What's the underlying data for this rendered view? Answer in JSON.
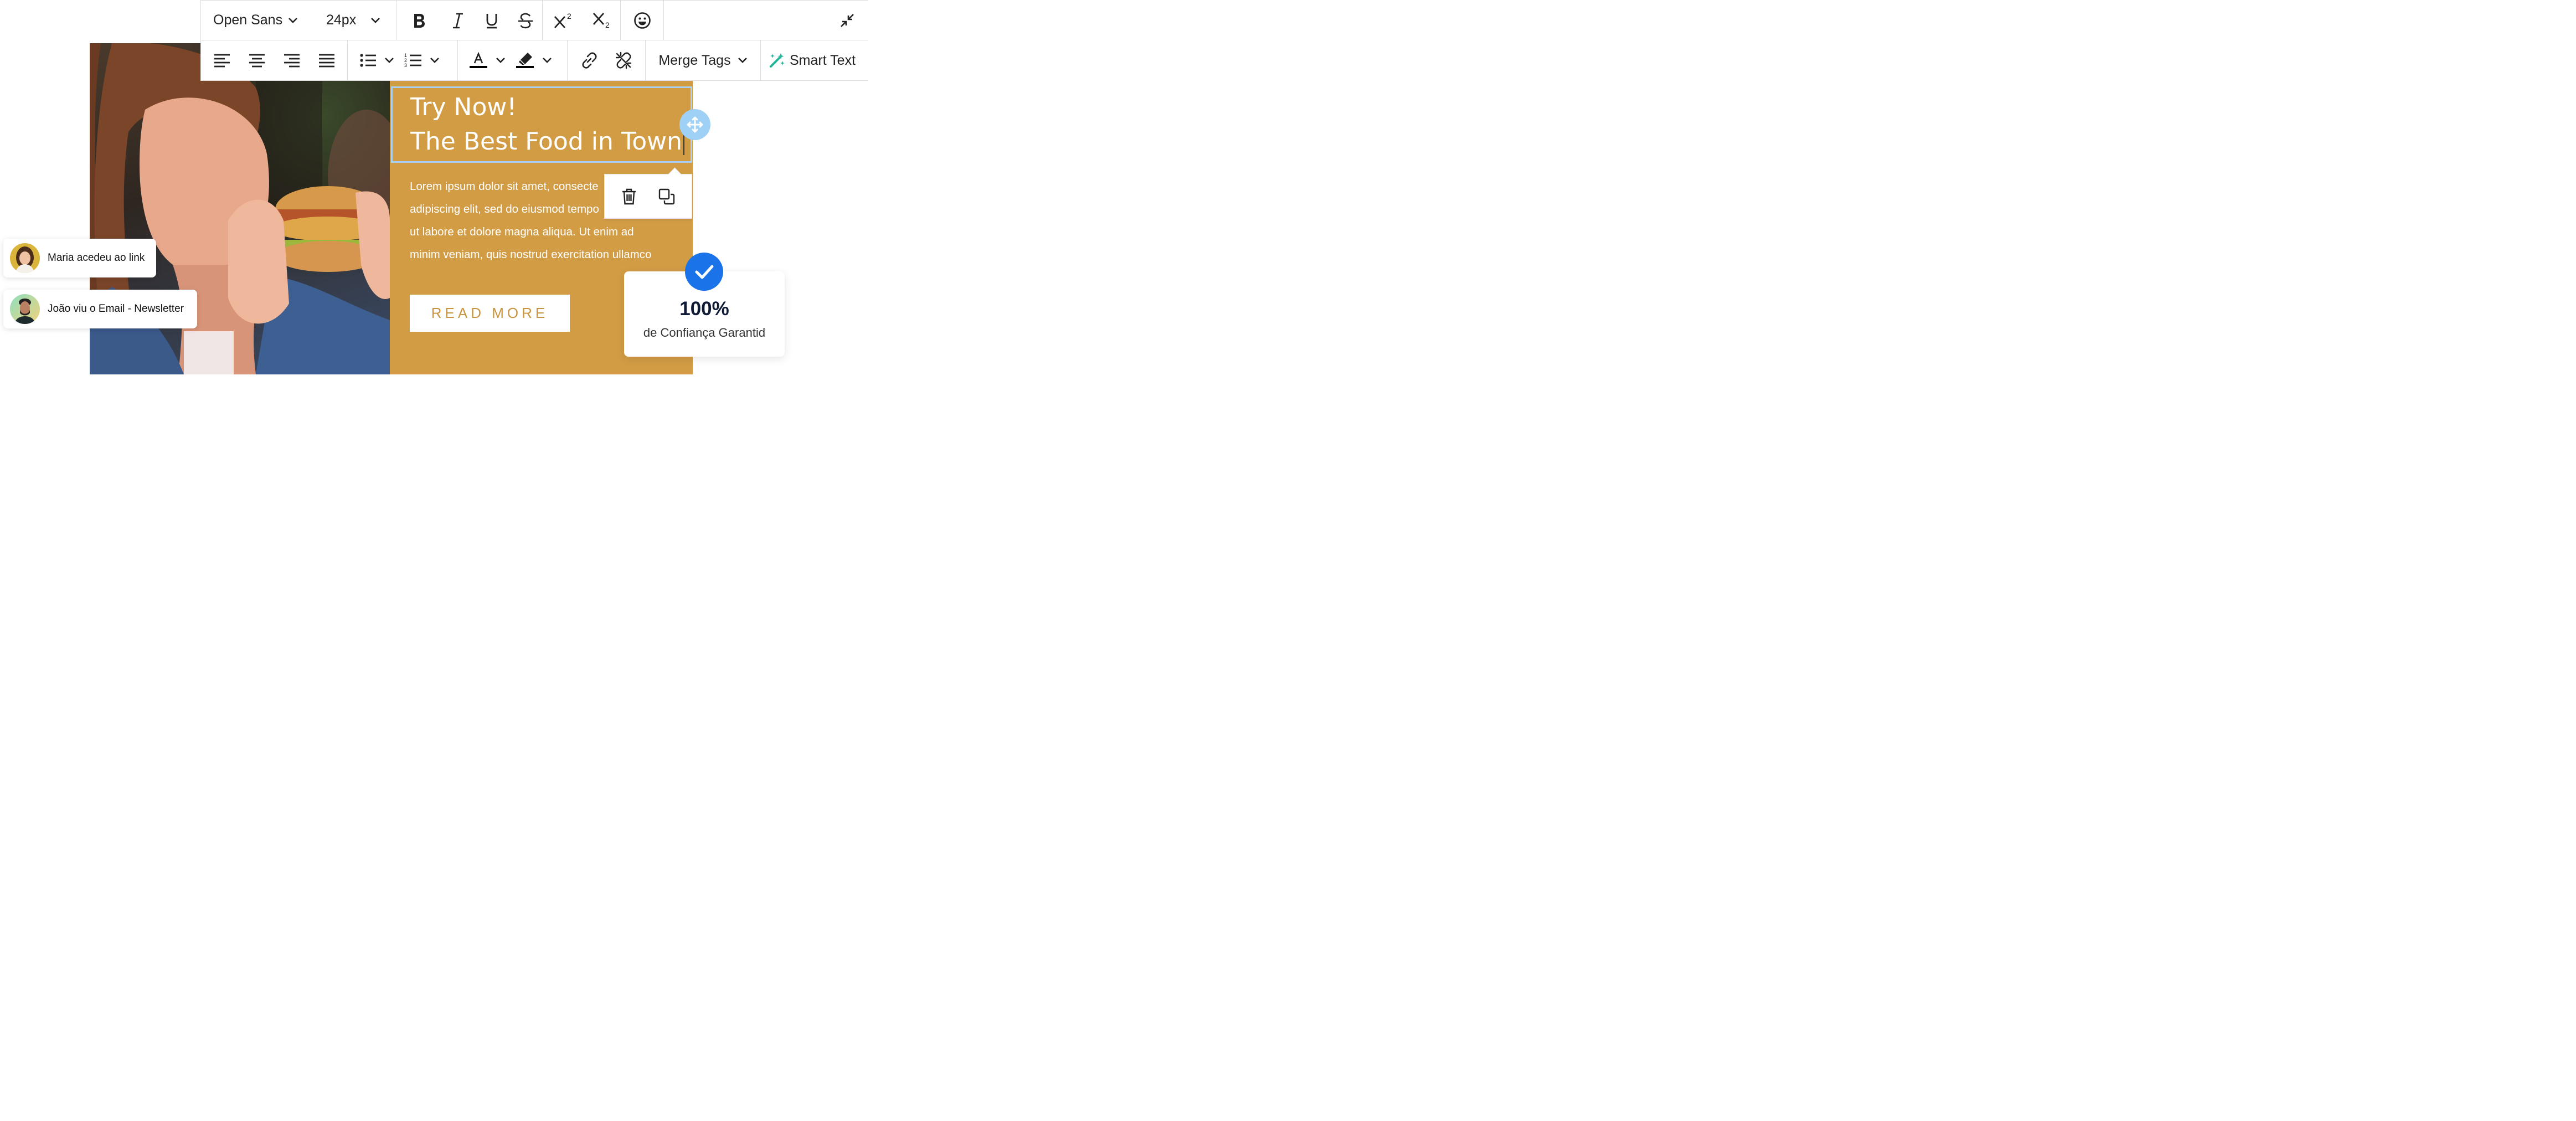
{
  "toolbar": {
    "font_family": "Open Sans",
    "font_size": "24px",
    "merge_tags_label": "Merge Tags",
    "smart_text_label": "Smart Text",
    "text_color": "#000000",
    "highlight_color": "#000000",
    "smart_text_icon_color": "#22b59a"
  },
  "editor": {
    "heading_line1": "Try Now!",
    "heading_line2": "The Best Food in Town",
    "body_lines": [
      "Lorem ipsum dolor sit amet, consecte",
      "adipiscing elit, sed do eiusmod tempo",
      "ut labore et dolore magna aliqua. Ut enim ad",
      "minim veniam, quis nostrud exercitation ullamco"
    ],
    "button_label": "READ MORE",
    "panel_color": "#d29c45",
    "selection_color": "#a9d0ee"
  },
  "notifications": [
    {
      "text": "Maria acedeu ao link",
      "avatar": "woman-avatar"
    },
    {
      "text": "João viu o Email - Newsletter",
      "avatar": "man-avatar"
    }
  ],
  "trust_card": {
    "percent": "100%",
    "caption": "de Confiança Garantid",
    "check_color": "#1a73e8"
  }
}
